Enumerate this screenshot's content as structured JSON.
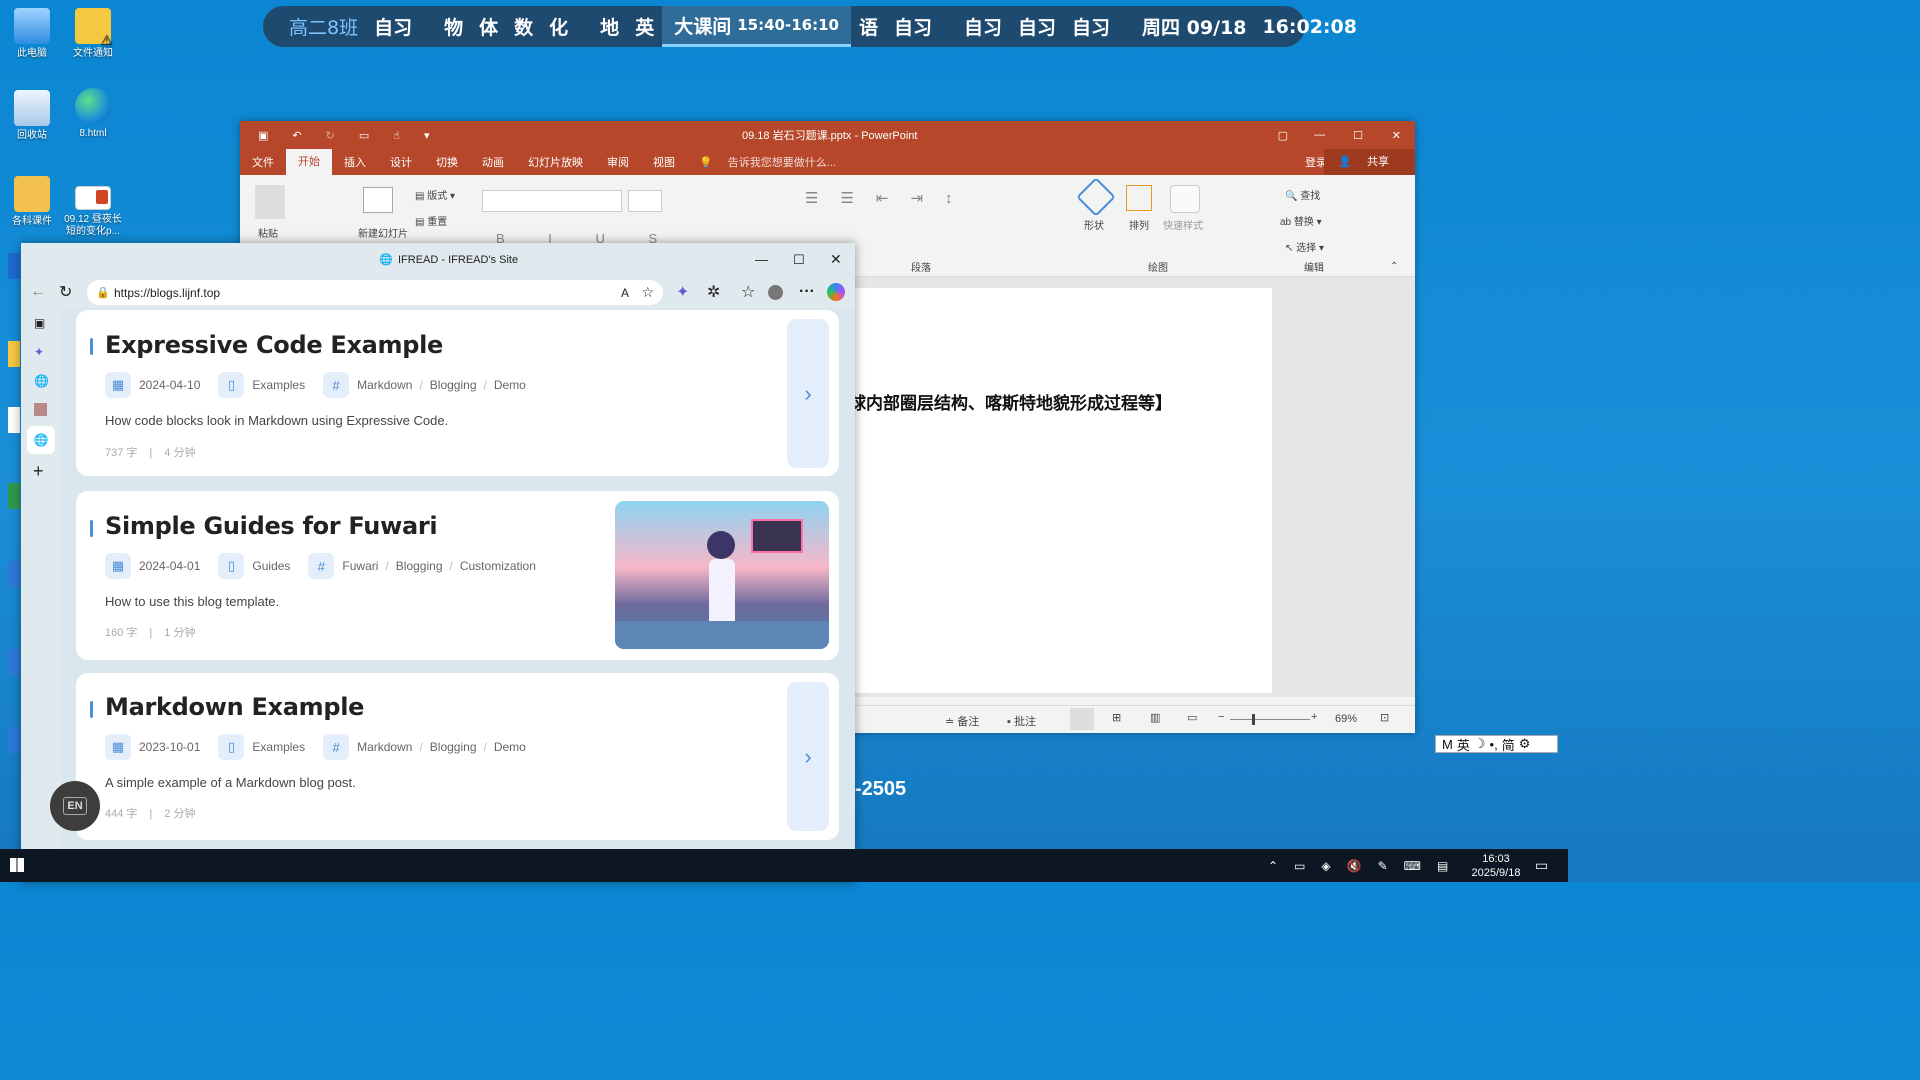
{
  "schedule": {
    "class_name": "高二8班",
    "blocks": [
      [
        "自习"
      ],
      [
        "物",
        "体",
        "数",
        "化"
      ],
      [
        "地",
        "英"
      ]
    ],
    "current_label": "大课间",
    "current_time": "15:40-16:10",
    "after_blocks": [
      [
        "语",
        "自习"
      ],
      [
        "自习",
        "自习",
        "自习"
      ]
    ],
    "weekday_date": "周四 09/18",
    "clock": "16:02:08"
  },
  "desktop_icons": [
    {
      "label": "此电脑",
      "icon": "computer-icon"
    },
    {
      "label": "文件通知",
      "icon": "folder-warning-icon"
    },
    {
      "label": "回收站",
      "icon": "recycle-bin-icon"
    },
    {
      "label": "8.html",
      "icon": "edge-icon"
    },
    {
      "label": "各科课件",
      "icon": "folder-icon"
    },
    {
      "label": "09.12 昼夜长短的变化p...",
      "icon": "pptx-file-icon"
    }
  ],
  "ppt": {
    "title": "09.18 岩石习题课.pptx - PowerPoint",
    "tabs": [
      "文件",
      "开始",
      "插入",
      "设计",
      "切换",
      "动画",
      "幻灯片放映",
      "审阅",
      "视图"
    ],
    "active_tab": "开始",
    "tell_me": "告诉我您想要做什么...",
    "login": "登录",
    "share": "共享",
    "ribbon": {
      "paste": "粘贴",
      "new_slide": "新建幻灯片",
      "layout": "版式",
      "reset": "重置",
      "paragraph": "段落",
      "shape": "形状",
      "arrange": "排列",
      "quick_style": "快速样式",
      "drawing": "绘图",
      "find": "查找",
      "replace": "替换",
      "select": "选择",
      "edit": "编辑"
    },
    "slide_text": "球内部圈层结构、喀斯特地貌形成过程等】",
    "status": {
      "notes": "备注",
      "comments": "批注",
      "zoom": "69%"
    }
  },
  "behind_text": "-2505",
  "browser": {
    "title": "IFREAD - IFREAD's Site",
    "url": "https://blogs.lijnf.top",
    "posts": [
      {
        "title": "Expressive Code Example",
        "date": "2024-04-10",
        "category": "Examples",
        "tags": [
          "Markdown",
          "Blogging",
          "Demo"
        ],
        "desc": "How code blocks look in Markdown using Expressive Code.",
        "words": "737 字",
        "time": "4 分钟"
      },
      {
        "title": "Simple Guides for Fuwari",
        "date": "2024-04-01",
        "category": "Guides",
        "tags": [
          "Fuwari",
          "Blogging",
          "Customization"
        ],
        "desc": "How to use this blog template.",
        "words": "160 字",
        "time": "1 分钟"
      },
      {
        "title": "Markdown Example",
        "date": "2023-10-01",
        "category": "Examples",
        "tags": [
          "Markdown",
          "Blogging",
          "Demo"
        ],
        "desc": "A simple example of a Markdown blog post.",
        "words": "444 字",
        "time": "2 分钟"
      }
    ],
    "lang_button": "EN"
  },
  "ime": {
    "mode": "M",
    "lang": "英",
    "simp": "简"
  },
  "taskbar": {
    "time": "16:03",
    "date": "2025/9/18"
  }
}
